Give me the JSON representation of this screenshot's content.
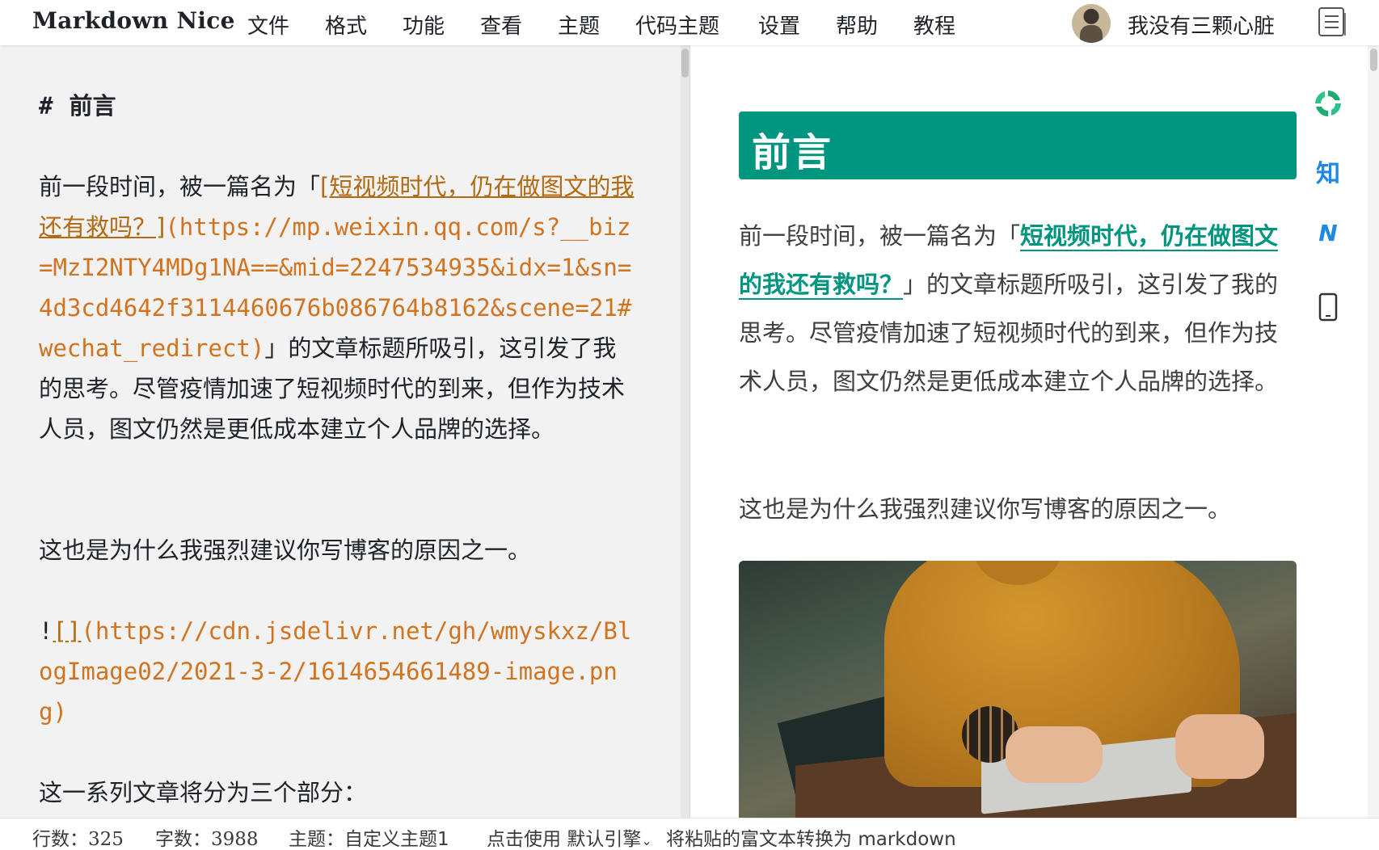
{
  "app": {
    "brand": "Markdown Nice"
  },
  "menu": [
    "文件",
    "格式",
    "功能",
    "查看",
    "主题",
    "代码主题",
    "设置",
    "帮助",
    "教程"
  ],
  "user": {
    "name": "我没有三颗心脏"
  },
  "editor": {
    "heading_hash": "#",
    "heading_text": "前言",
    "para1_prefix": "前一段时间，被一篇名为「",
    "para1_link_text": "[短视频时代，仍在做图文的我还有救吗？]",
    "para1_url": "(https://mp.weixin.qq.com/s?__biz=MzI2NTY4MDg1NA==&mid=2247534935&idx=1&sn=4d3cd4642f3114460676b086764b8162&scene=21#wechat_redirect)",
    "para1_suffix": "」的文章标题所吸引，这引发了我的思考。尽管疫情加速了短视频时代的到来，但作为技术人员，图文仍然是更低成本建立个人品牌的选择。",
    "para2": "这也是为什么我强烈建议你写博客的原因之一。",
    "image_bang": "!",
    "image_alt": "[]",
    "image_url": "(https://cdn.jsdelivr.net/gh/wmyskxz/BlogImage02/2021-3-2/1614654661489-image.png)",
    "para3": "这一系列文章将分为三个部分："
  },
  "preview": {
    "heading": "前言",
    "para1_prefix": "前一段时间，被一篇名为「",
    "para1_link": "短视频时代，仍在做图文的我还有救吗？",
    "para1_suffix": "」的文章标题所吸引，这引发了我的思考。尽管疫情加速了短视频时代的到来，但作为技术人员，图文仍然是更低成本建立个人品牌的选择。",
    "para2": "这也是为什么我强烈建议你写博客的原因之一。"
  },
  "side_icons": {
    "zhihu": "知",
    "juejin": "N"
  },
  "colors": {
    "accent": "#00957f",
    "link_md": "#b36a12",
    "url_md": "#d2731f"
  },
  "status": {
    "lines_label": "行数：",
    "lines_value": "325",
    "words_label": "字数：",
    "words_value": "3988",
    "theme_label": "主题：",
    "theme_value": "自定义主题1",
    "convert_prefix": "点击使用",
    "engine": "默认引擎",
    "convert_suffix": "将粘贴的富文本转换为 markdown"
  }
}
